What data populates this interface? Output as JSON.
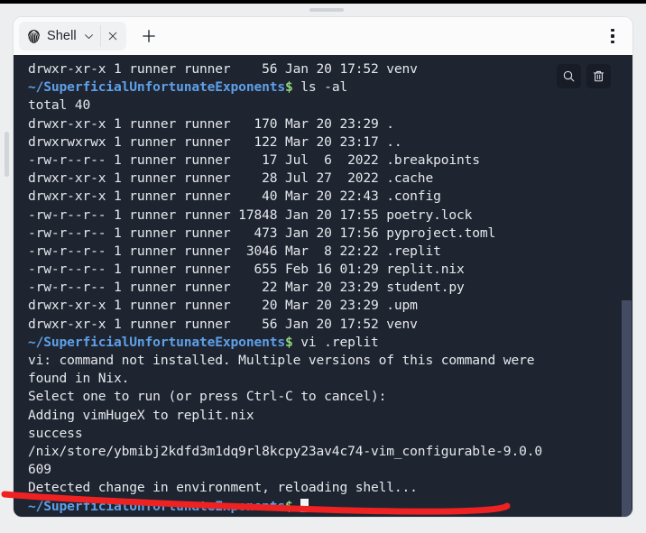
{
  "window": {
    "tab": {
      "label": "Shell",
      "icon": "shell-icon",
      "dropdown_icon": "chevron-down-icon",
      "close_icon": "close-icon"
    },
    "new_tab_icon": "plus-icon",
    "overflow_menu_icon": "kebab-menu-icon"
  },
  "terminal": {
    "search_icon": "search-icon",
    "clear_icon": "trash-icon",
    "prompt": "~/SuperficialUnfortunateExponents",
    "prompt_symbol": "$",
    "colors": {
      "background": "#1e2430",
      "text": "#e6e8ec",
      "prompt": "#5ea0e8",
      "dollar": "#8fd67a",
      "scrollbar_thumb": "#434c63",
      "annotation": "#ee2222"
    },
    "lines": [
      {
        "type": "output",
        "text": "drwxr-xr-x 1 runner runner    56 Jan 20 17:52 venv"
      },
      {
        "type": "prompt",
        "command": " ls -al"
      },
      {
        "type": "output",
        "text": "total 40"
      },
      {
        "type": "output",
        "text": "drwxr-xr-x 1 runner runner   170 Mar 20 23:29 ."
      },
      {
        "type": "output",
        "text": "drwxrwxrwx 1 runner runner   122 Mar 20 23:17 .."
      },
      {
        "type": "output",
        "text": "-rw-r--r-- 1 runner runner    17 Jul  6  2022 .breakpoints"
      },
      {
        "type": "output",
        "text": "drwxr-xr-x 1 runner runner    28 Jul 27  2022 .cache"
      },
      {
        "type": "output",
        "text": "drwxr-xr-x 1 runner runner    40 Mar 20 22:43 .config"
      },
      {
        "type": "output",
        "text": "-rw-r--r-- 1 runner runner 17848 Jan 20 17:55 poetry.lock"
      },
      {
        "type": "output",
        "text": "-rw-r--r-- 1 runner runner   473 Jan 20 17:56 pyproject.toml"
      },
      {
        "type": "output",
        "text": "-rw-r--r-- 1 runner runner  3046 Mar  8 22:22 .replit"
      },
      {
        "type": "output",
        "text": "-rw-r--r-- 1 runner runner   655 Feb 16 01:29 replit.nix"
      },
      {
        "type": "output",
        "text": "-rw-r--r-- 1 runner runner    22 Mar 20 23:29 student.py"
      },
      {
        "type": "output",
        "text": "drwxr-xr-x 1 runner runner    20 Mar 20 23:29 .upm"
      },
      {
        "type": "output",
        "text": "drwxr-xr-x 1 runner runner    56 Jan 20 17:52 venv"
      },
      {
        "type": "prompt",
        "command": " vi .replit"
      },
      {
        "type": "output",
        "text": "vi: command not installed. Multiple versions of this command were"
      },
      {
        "type": "output",
        "text": "found in Nix."
      },
      {
        "type": "output",
        "text": "Select one to run (or press Ctrl-C to cancel):"
      },
      {
        "type": "output",
        "text": "Adding vimHugeX to replit.nix"
      },
      {
        "type": "output",
        "text": "success"
      },
      {
        "type": "output",
        "text": "/nix/store/ybmibj2kdfd3m1dq9rl8kcpy23av4c74-vim_configurable-9.0.0"
      },
      {
        "type": "output",
        "text": "609"
      },
      {
        "type": "output",
        "text": "Detected change in environment, reloading shell..."
      },
      {
        "type": "prompt-cursor",
        "command": " "
      }
    ]
  },
  "annotation": {
    "shape": "red-underline-stroke",
    "color": "#ee2222"
  }
}
